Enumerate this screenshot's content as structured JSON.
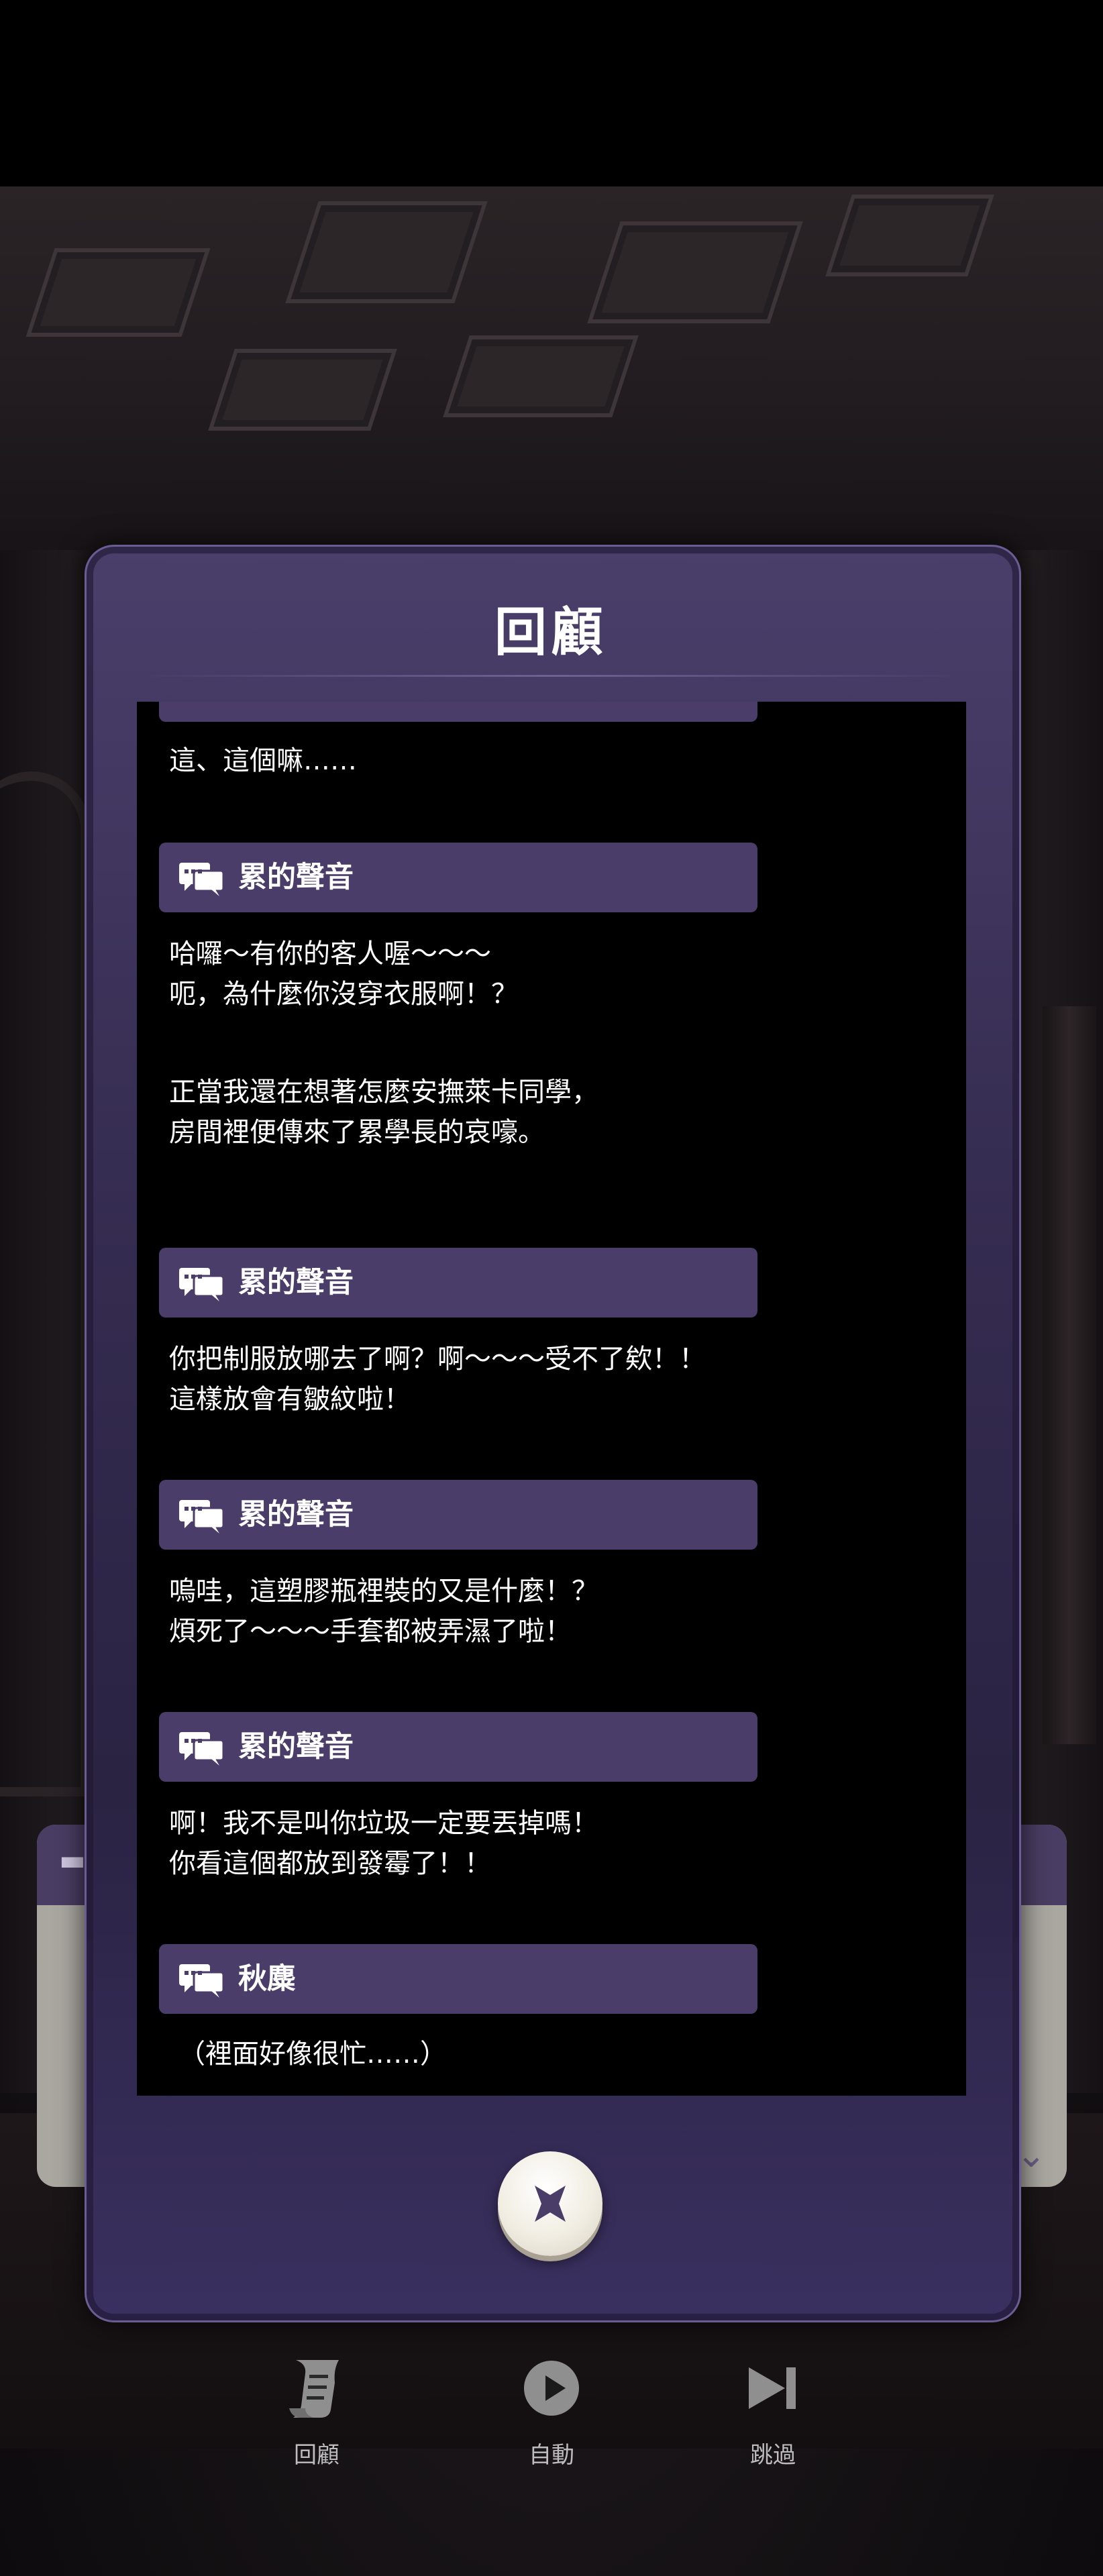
{
  "modal": {
    "title": "回顧",
    "close_icon": "close-x-icon"
  },
  "log": {
    "partial_top_line": "這、這個嘛……",
    "entries": [
      {
        "speaker": "累的聲音",
        "lines": [
          "哈囉〜有你的客人喔〜〜〜",
          "呃，為什麼你沒穿衣服啊！？"
        ]
      },
      {
        "speaker": "",
        "lines": [
          "正當我還在想著怎麼安撫萊卡同學，",
          "房間裡便傳來了累學長的哀嚎。"
        ]
      },
      {
        "speaker": "累的聲音",
        "lines": [
          "你把制服放哪去了啊？啊〜〜〜受不了欸！！",
          "這樣放會有皺紋啦！"
        ]
      },
      {
        "speaker": "累的聲音",
        "lines": [
          "嗚哇，這塑膠瓶裡裝的又是什麼！？",
          "煩死了〜〜〜手套都被弄濕了啦！"
        ]
      },
      {
        "speaker": "累的聲音",
        "lines": [
          "啊！我不是叫你垃圾一定要丟掉嗎！",
          "你看這個都放到發霉了！！"
        ]
      },
      {
        "speaker": "秋麋",
        "lines": [
          "（裡面好像很忙……）"
        ]
      }
    ]
  },
  "controls": [
    {
      "label": "回顧",
      "icon": "scroll-icon"
    },
    {
      "label": "自動",
      "icon": "play-icon"
    },
    {
      "label": "跳過",
      "icon": "skip-icon"
    }
  ],
  "colors": {
    "speaker_bar": "#4b3d69",
    "modal_frame": "#362d52",
    "log_background": "#000000"
  }
}
